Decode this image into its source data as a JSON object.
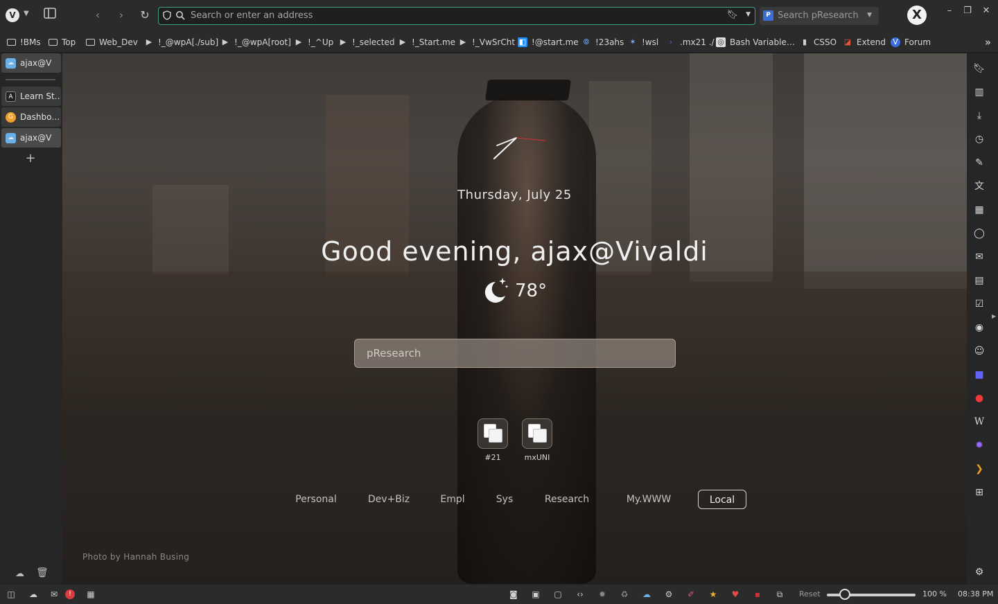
{
  "toolbar": {
    "address_placeholder": "Search or enter an address",
    "search_engine_placeholder": "Search pResearch",
    "search_engine_icon_label": "P",
    "avatar_letter": "X",
    "accent_color": "#3b9e8a"
  },
  "bookmarks": [
    {
      "label": "!BMs",
      "icon": "folder-icon"
    },
    {
      "label": "Top",
      "icon": "folder-icon"
    },
    {
      "label": "Web_Dev",
      "icon": "folder-icon"
    },
    {
      "label": "!_@wpA[./sub]",
      "icon": "bookmarklet-icon"
    },
    {
      "label": "!_@wpA[root]",
      "icon": "bookmarklet-icon"
    },
    {
      "label": "!_^Up",
      "icon": "bookmarklet-icon"
    },
    {
      "label": "!_selected",
      "icon": "bookmarklet-icon"
    },
    {
      "label": "!_Start.me",
      "icon": "bookmarklet-icon"
    },
    {
      "label": "!_VwSrCht",
      "icon": "bookmarklet-icon"
    },
    {
      "label": "!@start.me",
      "icon": "startme-icon"
    },
    {
      "label": "!23ahs",
      "icon": "fingerprint-icon"
    },
    {
      "label": "!wsl",
      "icon": "star-burst-icon"
    },
    {
      "label": ".mx21 ./",
      "icon": "terminal-icon"
    },
    {
      "label": "Bash Variable…",
      "icon": "bash-icon"
    },
    {
      "label": "CSSO",
      "icon": "file-icon"
    },
    {
      "label": "Extend",
      "icon": "extend-icon"
    },
    {
      "label": "Forum",
      "icon": "vivaldi-icon"
    }
  ],
  "tabs": {
    "pinned": {
      "label": "ajax@V"
    },
    "items": [
      {
        "label": "Learn St…",
        "icon": "code-icon"
      },
      {
        "label": "Dashbo…",
        "icon": "gauge-icon"
      },
      {
        "label": "ajax@V",
        "icon": "weather-icon"
      }
    ]
  },
  "page": {
    "date": "Thursday, July 25",
    "greeting": "Good evening, ajax@Vivaldi",
    "temperature": "78°",
    "weather_icon": "moon-stars-icon",
    "search_placeholder": "pResearch",
    "speed_dials": [
      {
        "label": "#21"
      },
      {
        "label": "mxUNI"
      }
    ],
    "categories": [
      {
        "label": "Personal",
        "active": false
      },
      {
        "label": "Dev+Biz",
        "active": false
      },
      {
        "label": "Empl",
        "active": false
      },
      {
        "label": "Sys",
        "active": false
      },
      {
        "label": "Research",
        "active": false
      },
      {
        "label": "My.WWW",
        "active": false
      },
      {
        "label": "Local",
        "active": true
      }
    ],
    "photo_credit": "Photo by Hannah Busing"
  },
  "panel_icons": [
    "bookmarks-icon",
    "reading-list-icon",
    "downloads-icon",
    "history-icon",
    "notes-icon",
    "translate-icon",
    "calendar-icon",
    "chat-icon",
    "mail-icon",
    "calendar-grid-icon",
    "tasks-icon",
    "feeds-icon",
    "contacts-icon",
    "mastodon-icon",
    "vivaldi-red-icon",
    "wikipedia-icon",
    "puzzle-gear-icon",
    "chevron-orange-icon",
    "add-panel-icon"
  ],
  "statusbar": {
    "reset_label": "Reset",
    "zoom": "100 %",
    "zoom_level": 1.0,
    "time": "08:38 PM",
    "alert_badge": "!"
  }
}
